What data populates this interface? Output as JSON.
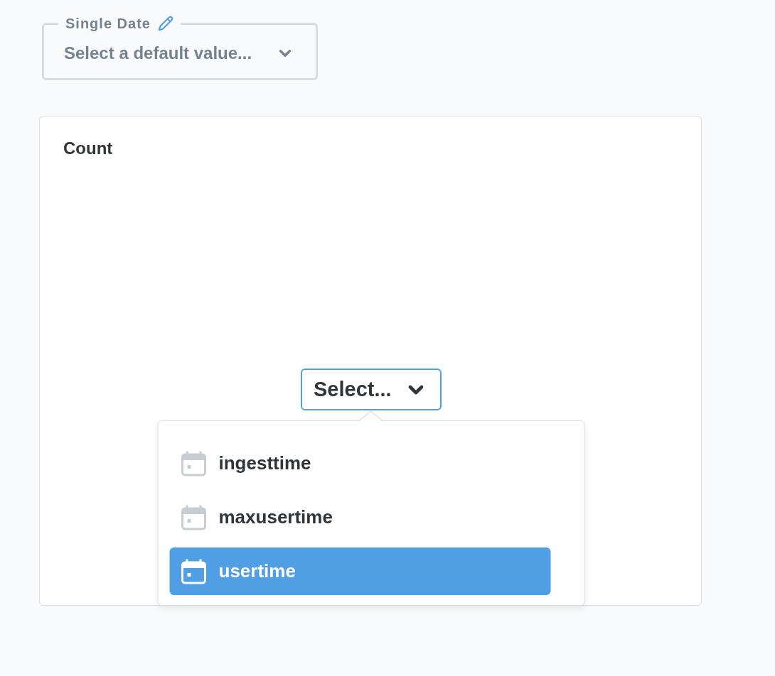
{
  "filter": {
    "label": "Single Date",
    "placeholder": "Select a default value..."
  },
  "card": {
    "title": "Count",
    "select": {
      "label": "Select...",
      "open": true,
      "options": [
        {
          "label": "ingesttime",
          "selected": false
        },
        {
          "label": "maxusertime",
          "selected": false
        },
        {
          "label": "usertime",
          "selected": true
        }
      ]
    }
  }
}
